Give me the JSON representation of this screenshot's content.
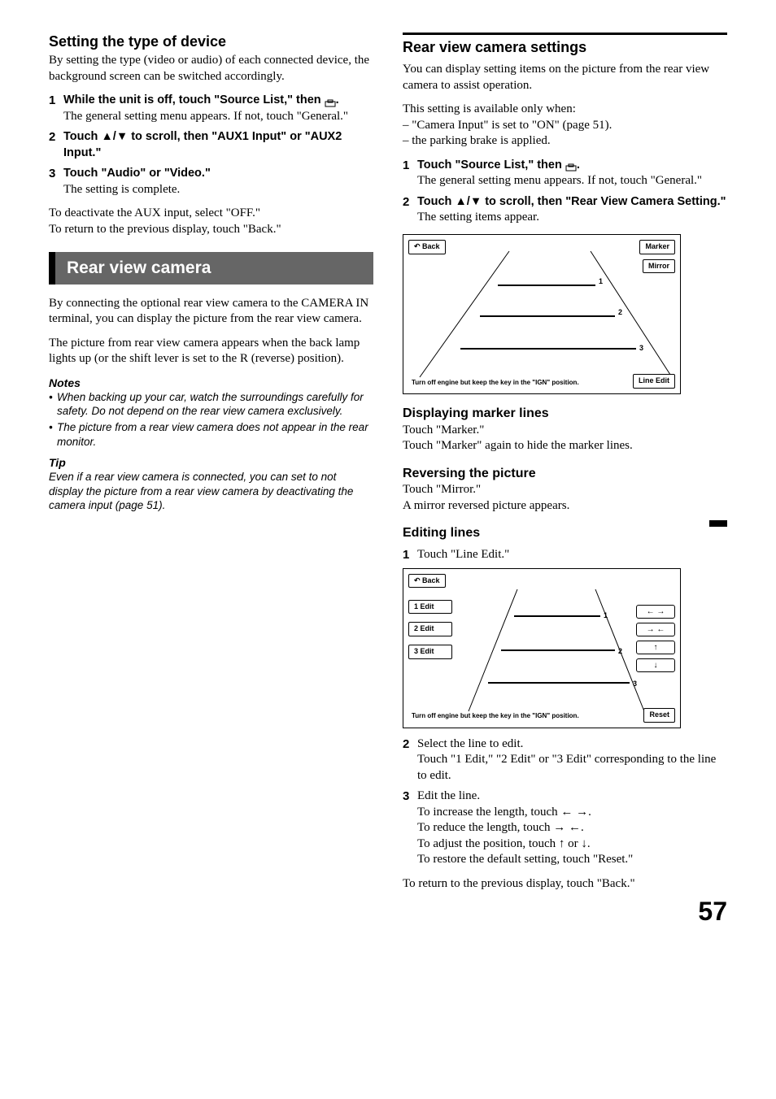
{
  "left": {
    "h_devtype": "Setting the type of device",
    "devtype_intro": "By setting the type (video or audio) of each connected device, the background screen can be switched accordingly.",
    "devsteps": [
      {
        "num": "1",
        "bold": "While the unit is off, touch \"Source List,\" then ",
        "bold2": ".",
        "norm": "The general setting menu appears. If not, touch \"General.\""
      },
      {
        "num": "2",
        "bold": "Touch ▲/▼ to scroll, then \"AUX1 Input\" or \"AUX2 Input.\""
      },
      {
        "num": "3",
        "bold": "Touch \"Audio\" or \"Video.\"",
        "norm": "The setting is complete."
      }
    ],
    "dev_after1": "To deactivate the AUX input, select \"OFF.\"",
    "dev_after2": "To return to the previous display, touch \"Back.\"",
    "band": "Rear view camera",
    "rvc_p1": "By connecting the optional rear view camera to the CAMERA IN terminal, you can display the picture from the rear view camera.",
    "rvc_p2": "The picture from rear view camera appears when the back lamp lights up (or the shift lever is set to the R (reverse) position).",
    "notes_h": "Notes",
    "notes": [
      "When backing up your car, watch the surroundings carefully for safety. Do not depend on the rear view camera exclusively.",
      "The picture from a rear view camera does not appear in the rear monitor."
    ],
    "tip_h": "Tip",
    "tip": "Even if a rear view camera is connected, you can set to not display the picture from a rear view camera by deactivating the camera input (page 51)."
  },
  "right": {
    "h_settings": "Rear view camera settings",
    "settings_intro": "You can display setting items on the picture from the rear view camera to assist operation.",
    "avail_lead": "This setting is available only when:",
    "avail": [
      "– \"Camera Input\" is set to \"ON\" (page 51).",
      "– the parking brake is applied."
    ],
    "settings_steps": [
      {
        "num": "1",
        "bold": "Touch \"Source List,\" then ",
        "bold2": ".",
        "norm": "The general setting menu appears. If not, touch \"General.\""
      },
      {
        "num": "2",
        "bold": "Touch ▲/▼ to scroll, then \"Rear View Camera Setting.\"",
        "norm": "The setting items appear."
      }
    ],
    "fig1": {
      "back": "Back",
      "marker": "Marker",
      "mirror": "Mirror",
      "lineedit": "Line Edit",
      "note": "Turn off engine but keep the key in the \"IGN\" position.",
      "n1": "1",
      "n2": "2",
      "n3": "3"
    },
    "h_marker": "Displaying marker lines",
    "marker_p1": "Touch \"Marker.\"",
    "marker_p2": "Touch \"Marker\" again to hide the marker lines.",
    "h_reverse": "Reversing the picture",
    "rev_p1": "Touch \"Mirror.\"",
    "rev_p2": "A mirror reversed picture appears.",
    "h_edit": "Editing lines",
    "edit_steps": [
      {
        "num": "1",
        "norm": "Touch \"Line Edit.\""
      }
    ],
    "fig2": {
      "back": "Back",
      "e1": "1 Edit",
      "e2": "2 Edit",
      "e3": "3 Edit",
      "reset": "Reset",
      "note": "Turn off engine but keep the key in the \"IGN\" position.",
      "n1": "1",
      "n2": "2",
      "n3": "3",
      "a_out": "← →",
      "a_in": "→ ←",
      "a_up": "↑",
      "a_down": "↓"
    },
    "edit_steps2": [
      {
        "num": "2",
        "norm": "Select the line to edit.",
        "norm2": "Touch \"1 Edit,\" \"2 Edit\" or \"3 Edit\" corresponding to the line to edit."
      },
      {
        "num": "3",
        "norm": "Edit the line.",
        "lines": [
          "To increase the length, touch ← →.",
          "To reduce the length, touch → ←.",
          "To adjust the position, touch ↑ or ↓.",
          "To restore the default setting, touch \"Reset.\""
        ]
      }
    ],
    "return": "To return to the previous display, touch \"Back.\""
  },
  "page": "57"
}
